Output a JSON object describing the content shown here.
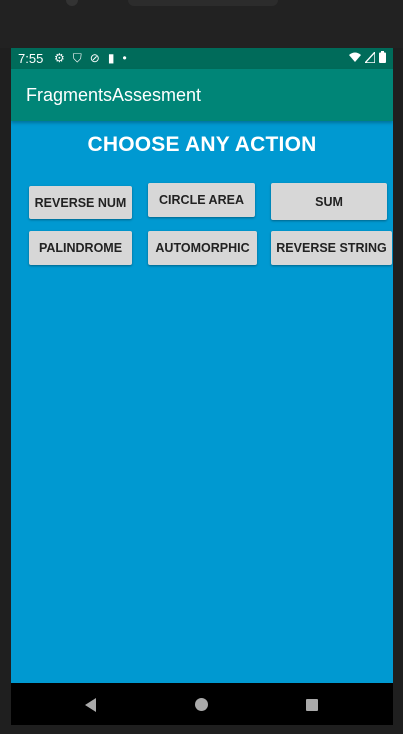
{
  "status_bar": {
    "time": "7:55",
    "icons": [
      "settings-icon",
      "shield-icon",
      "blocked-icon",
      "sd-card-icon",
      "dot-icon"
    ],
    "right_icons": [
      "wifi-icon",
      "signal-icon",
      "battery-icon"
    ]
  },
  "app_bar": {
    "title": "FragmentsAssesment"
  },
  "main": {
    "heading": "CHOOSE ANY ACTION",
    "buttons": [
      {
        "label": "REVERSE NUM"
      },
      {
        "label": "CIRCLE AREA"
      },
      {
        "label": "SUM"
      },
      {
        "label": "PALINDROME"
      },
      {
        "label": "AUTOMORPHIC"
      },
      {
        "label": "REVERSE STRING"
      }
    ]
  },
  "nav_bar": {
    "icons": [
      "back-icon",
      "home-icon",
      "recents-icon"
    ]
  },
  "colors": {
    "content_bg": "#0099d1",
    "app_bar": "#008577",
    "status_bar": "#006b5a",
    "button_bg": "#d7d7d7"
  }
}
